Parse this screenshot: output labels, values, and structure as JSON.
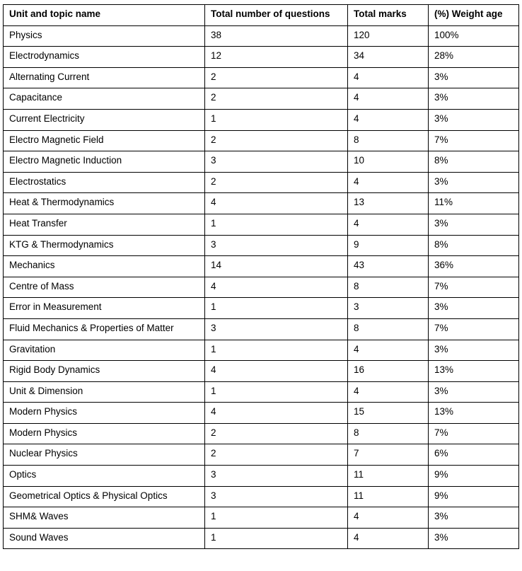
{
  "table": {
    "headers": [
      "Unit and topic name",
      "Total number of questions",
      "Total marks",
      "(%) Weight age"
    ],
    "rows": [
      [
        "Physics",
        "38",
        "120",
        "100%"
      ],
      [
        "Electrodynamics",
        "12",
        "34",
        "28%"
      ],
      [
        "Alternating Current",
        "2",
        "4",
        "3%"
      ],
      [
        "Capacitance",
        "2",
        "4",
        "3%"
      ],
      [
        "Current Electricity",
        "1",
        "4",
        "3%"
      ],
      [
        "Electro Magnetic Field",
        "2",
        "8",
        "7%"
      ],
      [
        "Electro Magnetic Induction",
        "3",
        "10",
        "8%"
      ],
      [
        "Electrostatics",
        "2",
        "4",
        "3%"
      ],
      [
        "Heat & Thermodynamics",
        "4",
        "13",
        "11%"
      ],
      [
        "Heat Transfer",
        "1",
        "4",
        "3%"
      ],
      [
        "KTG & Thermodynamics",
        "3",
        "9",
        "8%"
      ],
      [
        "Mechanics",
        "14",
        "43",
        "36%"
      ],
      [
        "Centre of Mass",
        "4",
        "8",
        "7%"
      ],
      [
        "Error in Measurement",
        "1",
        "3",
        "3%"
      ],
      [
        "Fluid Mechanics & Properties of Matter",
        "3",
        "8",
        "7%"
      ],
      [
        "Gravitation",
        "1",
        "4",
        "3%"
      ],
      [
        "Rigid Body Dynamics",
        "4",
        "16",
        "13%"
      ],
      [
        "Unit & Dimension",
        "1",
        "4",
        "3%"
      ],
      [
        "Modern Physics",
        "4",
        "15",
        "13%"
      ],
      [
        "Modern Physics",
        "2",
        "8",
        "7%"
      ],
      [
        "Nuclear Physics",
        "2",
        "7",
        "6%"
      ],
      [
        "Optics",
        "3",
        "11",
        "9%"
      ],
      [
        "Geometrical Optics & Physical Optics",
        "3",
        "11",
        "9%"
      ],
      [
        "SHM& Waves",
        "1",
        "4",
        "3%"
      ],
      [
        "Sound  Waves",
        "1",
        "4",
        "3%"
      ]
    ]
  }
}
